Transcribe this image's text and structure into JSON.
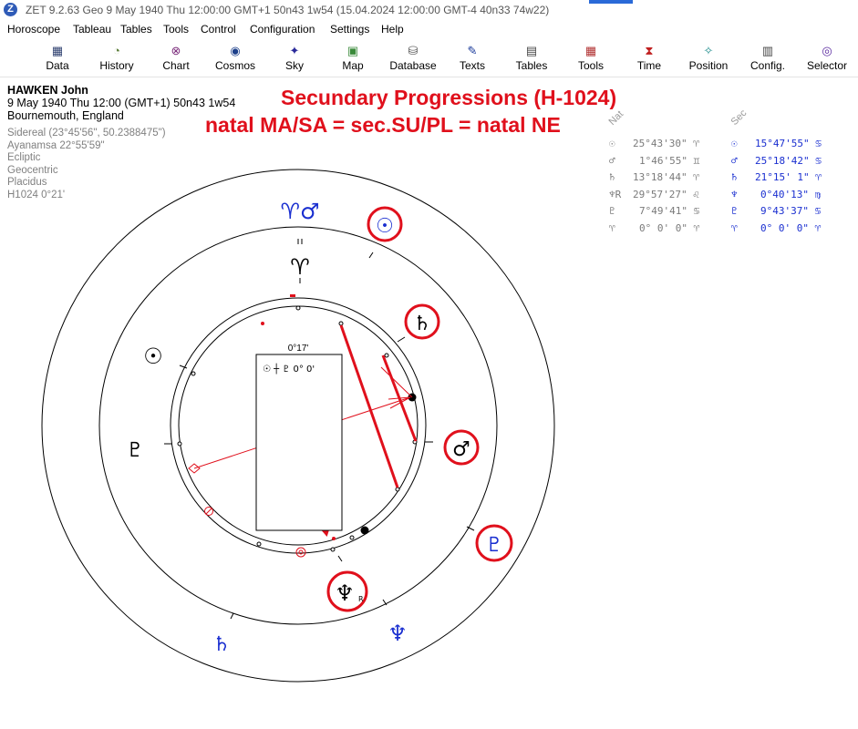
{
  "window": {
    "title": "ZET 9.2.63 Geo    9 May 1940  Thu  12:00:00 GMT+1 50n43  1w54  (15.04.2024  12:00:00 GMT-4 40n33 74w22)"
  },
  "menu": [
    "Horoscope",
    "Tableau",
    "Tables",
    "Tools",
    "Control",
    "Configuration",
    "Settings",
    "Help"
  ],
  "toolbar": [
    {
      "label": "Data",
      "icon": "data-icon",
      "glyph": "▦",
      "color": "#2c3e6e"
    },
    {
      "label": "History",
      "icon": "history-icon",
      "glyph": "◔",
      "color": "#5c7d3a"
    },
    {
      "label": "Chart",
      "icon": "chart-icon",
      "glyph": "⊗",
      "color": "#7a2a7a"
    },
    {
      "label": "Cosmos",
      "icon": "cosmos-icon",
      "glyph": "◉",
      "color": "#1c3f8a"
    },
    {
      "label": "Sky",
      "icon": "sky-icon",
      "glyph": "✦",
      "color": "#2a2a9a"
    },
    {
      "label": "Map",
      "icon": "map-icon",
      "glyph": "▣",
      "color": "#3a8a3a"
    },
    {
      "label": "Database",
      "icon": "database-icon",
      "glyph": "⛁",
      "color": "#555555"
    },
    {
      "label": "Texts",
      "icon": "texts-icon",
      "glyph": "✎",
      "color": "#1a3a9a"
    },
    {
      "label": "Tables",
      "icon": "tables-icon",
      "glyph": "▤",
      "color": "#444444"
    },
    {
      "label": "Tools",
      "icon": "tools-icon",
      "glyph": "▦",
      "color": "#b03030"
    },
    {
      "label": "Time",
      "icon": "time-icon",
      "glyph": "⧗",
      "color": "#c02020"
    },
    {
      "label": "Position",
      "icon": "position-icon",
      "glyph": "✧",
      "color": "#1a8a8a"
    },
    {
      "label": "Config.",
      "icon": "config-icon",
      "glyph": "▥",
      "color": "#444444"
    },
    {
      "label": "Selector",
      "icon": "selector-icon",
      "glyph": "◎",
      "color": "#5a2aa0"
    }
  ],
  "person": {
    "name": "HAWKEN John",
    "date_line": "9 May 1940  Thu  12:00 (GMT+1) 50n43  1w54",
    "place": "Bournemouth, England"
  },
  "settings_lines": [
    "Sidereal (23°45'56\", 50.2388475\")",
    "Ayanamsa 22°55'59\"",
    "Ecliptic",
    "Geocentric",
    "Placidus",
    "H1024   0°21'"
  ],
  "annotation": {
    "line1": "Secundary Progressions (H-1024)",
    "line2": "natal MA/SA = sec.SU/PL = natal NE",
    "color": "#e0101c"
  },
  "positions": {
    "nat_header": "Nat",
    "sec_header": "Sec",
    "rows": [
      {
        "nat_glyph": "☉",
        "nat_value": "25°43'30\" ♈",
        "sec_glyph": "☉",
        "sec_value": "15°47'55\" ♋"
      },
      {
        "nat_glyph": "♂",
        "nat_value": "1°46'55\" ♊",
        "sec_glyph": "♂",
        "sec_value": "25°18'42\" ♋"
      },
      {
        "nat_glyph": "♄",
        "nat_value": "13°18'44\" ♈",
        "sec_glyph": "♄",
        "sec_value": "21°15' 1\" ♈"
      },
      {
        "nat_glyph": "♆R",
        "nat_value": "29°57'27\" ♌",
        "sec_glyph": "♆",
        "sec_value": "0°40'13\" ♍"
      },
      {
        "nat_glyph": "♇",
        "nat_value": "7°49'41\" ♋",
        "sec_glyph": "♇",
        "sec_value": "9°43'37\" ♋"
      },
      {
        "nat_glyph": "♈",
        "nat_value": "0° 0' 0\" ♈",
        "sec_glyph": "♈",
        "sec_value": "0° 0' 0\" ♈"
      }
    ]
  },
  "chart": {
    "center_box_label": "0°17'",
    "center_box_formula": "☉ ┼ ♇   0° 0'",
    "outer_glyphs": {
      "aries_mars": "♈♂",
      "sun": "☉",
      "saturn": "♄",
      "mars": "♂",
      "pluto": "♇",
      "neptune": "♆",
      "saturn_outer": "♄"
    },
    "inner_glyphs": {
      "aries": "♈",
      "sun": "☉",
      "pluto": "♇",
      "neptune": "♆",
      "retro": "R"
    },
    "accent_red": "#e0101c",
    "sec_blue": "#1a2fd0"
  }
}
